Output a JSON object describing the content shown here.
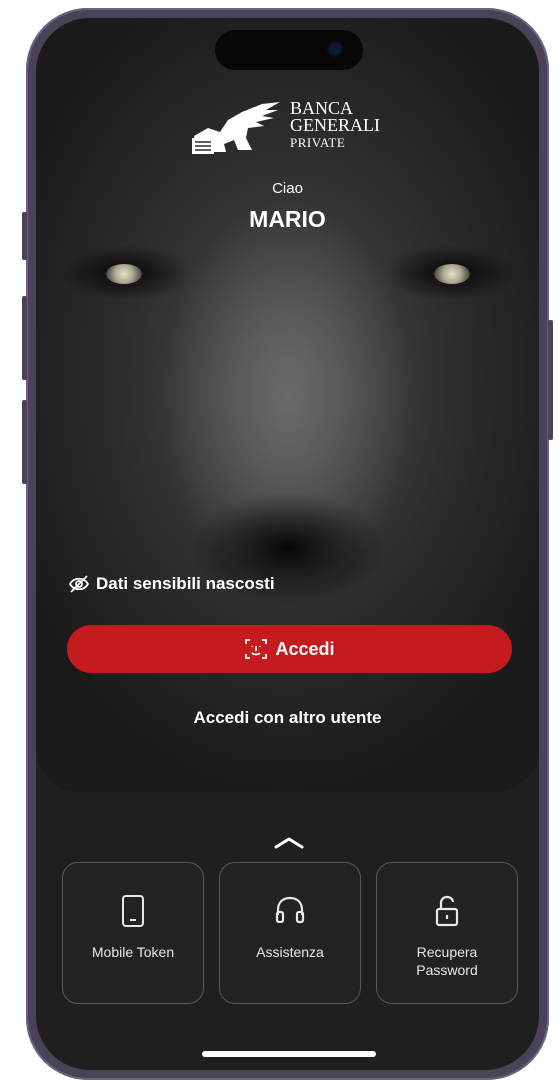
{
  "brand": {
    "line1": "BANCA",
    "line2": "GENERALI",
    "line3": "PRIVATE"
  },
  "greeting": {
    "hello": "Ciao",
    "name": "MARIO"
  },
  "privacy_toggle": {
    "label": "Dati sensibili nascosti",
    "icon": "eye-off-icon"
  },
  "login_button": {
    "label": "Accedi",
    "icon": "face-id-icon",
    "color": "#c51b1f"
  },
  "other_user_link": "Accedi con altro utente",
  "expand_icon": "chevron-up-icon",
  "quick_actions": [
    {
      "label": "Mobile Token",
      "icon": "smartphone-icon"
    },
    {
      "label": "Assistenza",
      "icon": "headset-icon"
    },
    {
      "label": "Recupera\nPassword",
      "icon": "unlock-icon"
    }
  ],
  "colors": {
    "accent": "#c51b1f",
    "background": "#1f1f1f",
    "frame": "#4a4358"
  }
}
